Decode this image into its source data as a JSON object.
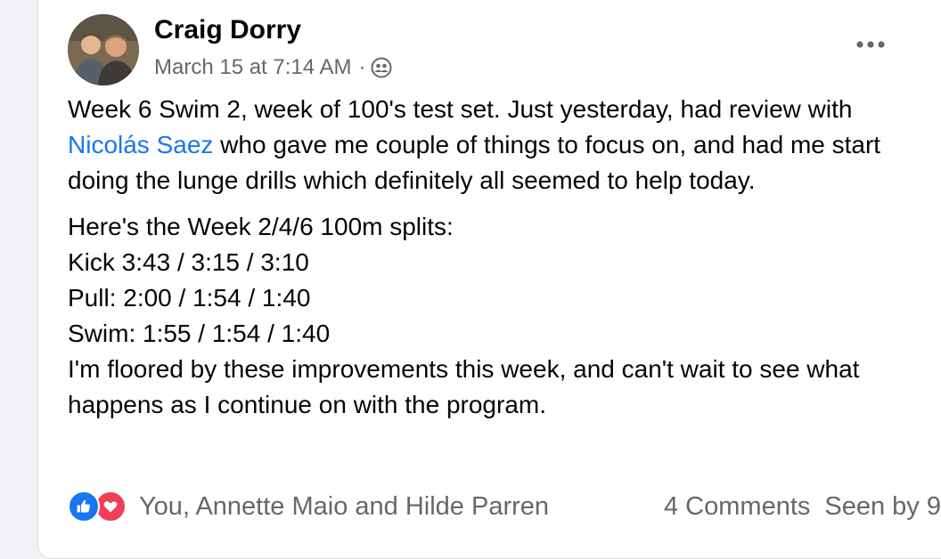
{
  "post": {
    "author": "Craig Dorry",
    "timestamp": "March 15 at 7:14 AM",
    "separator": "·",
    "audience_icon": "friends-icon",
    "more_icon": "more-options-icon",
    "body": {
      "p1_before": "Week 6 Swim 2, week of 100's test set.  Just yesterday, had review with ",
      "mention": "Nicolás Saez",
      "p1_after": " who gave me couple of things to focus on, and had me start doing the lunge drills which definitely all seemed to help today.",
      "lines": [
        "Here's the Week 2/4/6 100m splits:",
        "Kick 3:43 / 3:15 / 3:10",
        "Pull: 2:00 / 1:54 / 1:40",
        "Swim: 1:55 / 1:54 / 1:40",
        "I'm floored by these improvements this week, and can't wait to see what happens as I continue on with the program."
      ]
    },
    "reactions": {
      "icons": [
        "like-icon",
        "love-icon"
      ],
      "reactors": "You, Annette Maio and Hilde Parren"
    },
    "comments": "4 Comments",
    "seen": "Seen by 9"
  },
  "colors": {
    "mention": "#1877f2",
    "like": "#1877f2",
    "love": "#f33e58",
    "secondary_text": "#65676b"
  }
}
